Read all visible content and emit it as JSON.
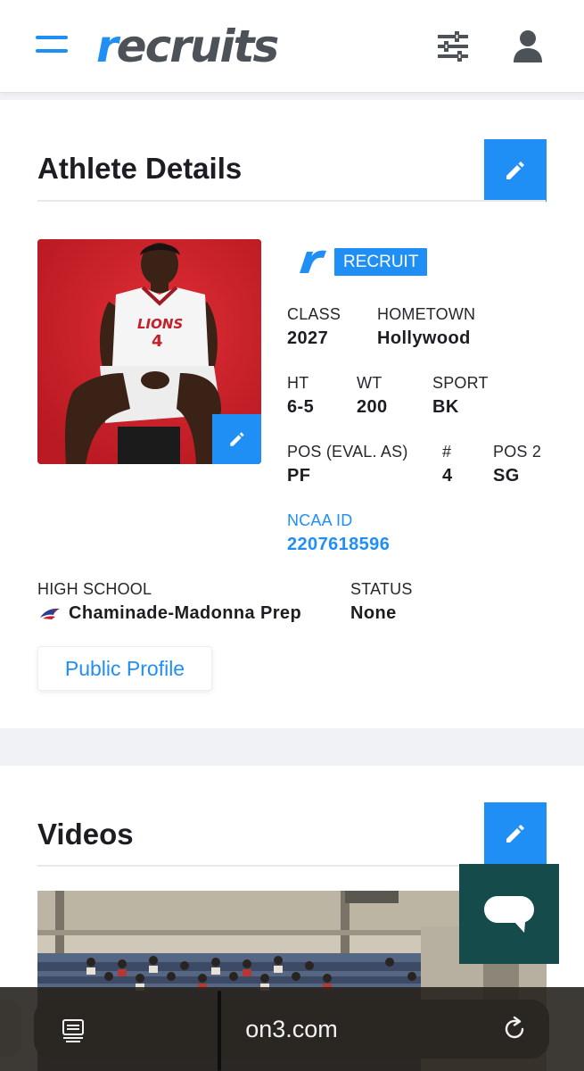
{
  "header": {
    "logo_r": "r",
    "logo_rest": "ecruits",
    "menu_icon": "hamburger-icon",
    "filter_icon": "sliders-icon",
    "account_icon": "user-icon",
    "accent_color": "#1f8ff5"
  },
  "athlete": {
    "section_title": "Athlete Details",
    "badge": "RECRUIT",
    "fields": {
      "class_label": "CLASS",
      "class_value": "2027",
      "hometown_label": "HOMETOWN",
      "hometown_value": "Hollywood",
      "ht_label": "HT",
      "ht_value": "6-5",
      "wt_label": "WT",
      "wt_value": "200",
      "sport_label": "SPORT",
      "sport_value": "BK",
      "pos_label": "POS (EVAL. AS)",
      "pos_value": "PF",
      "number_label": "#",
      "number_value": "4",
      "pos2_label": "POS 2",
      "pos2_value": "SG",
      "ncaa_label": "NCAA ID",
      "ncaa_value": "2207618596",
      "high_school_label": "HIGH SCHOOL",
      "high_school_value": "Chaminade-Madonna Prep",
      "status_label": "STATUS",
      "status_value": "None"
    },
    "jersey_text": "LIONS",
    "jersey_number": "4",
    "public_profile_label": "Public Profile"
  },
  "videos": {
    "section_title": "Videos"
  },
  "browser": {
    "url": "on3.com"
  }
}
